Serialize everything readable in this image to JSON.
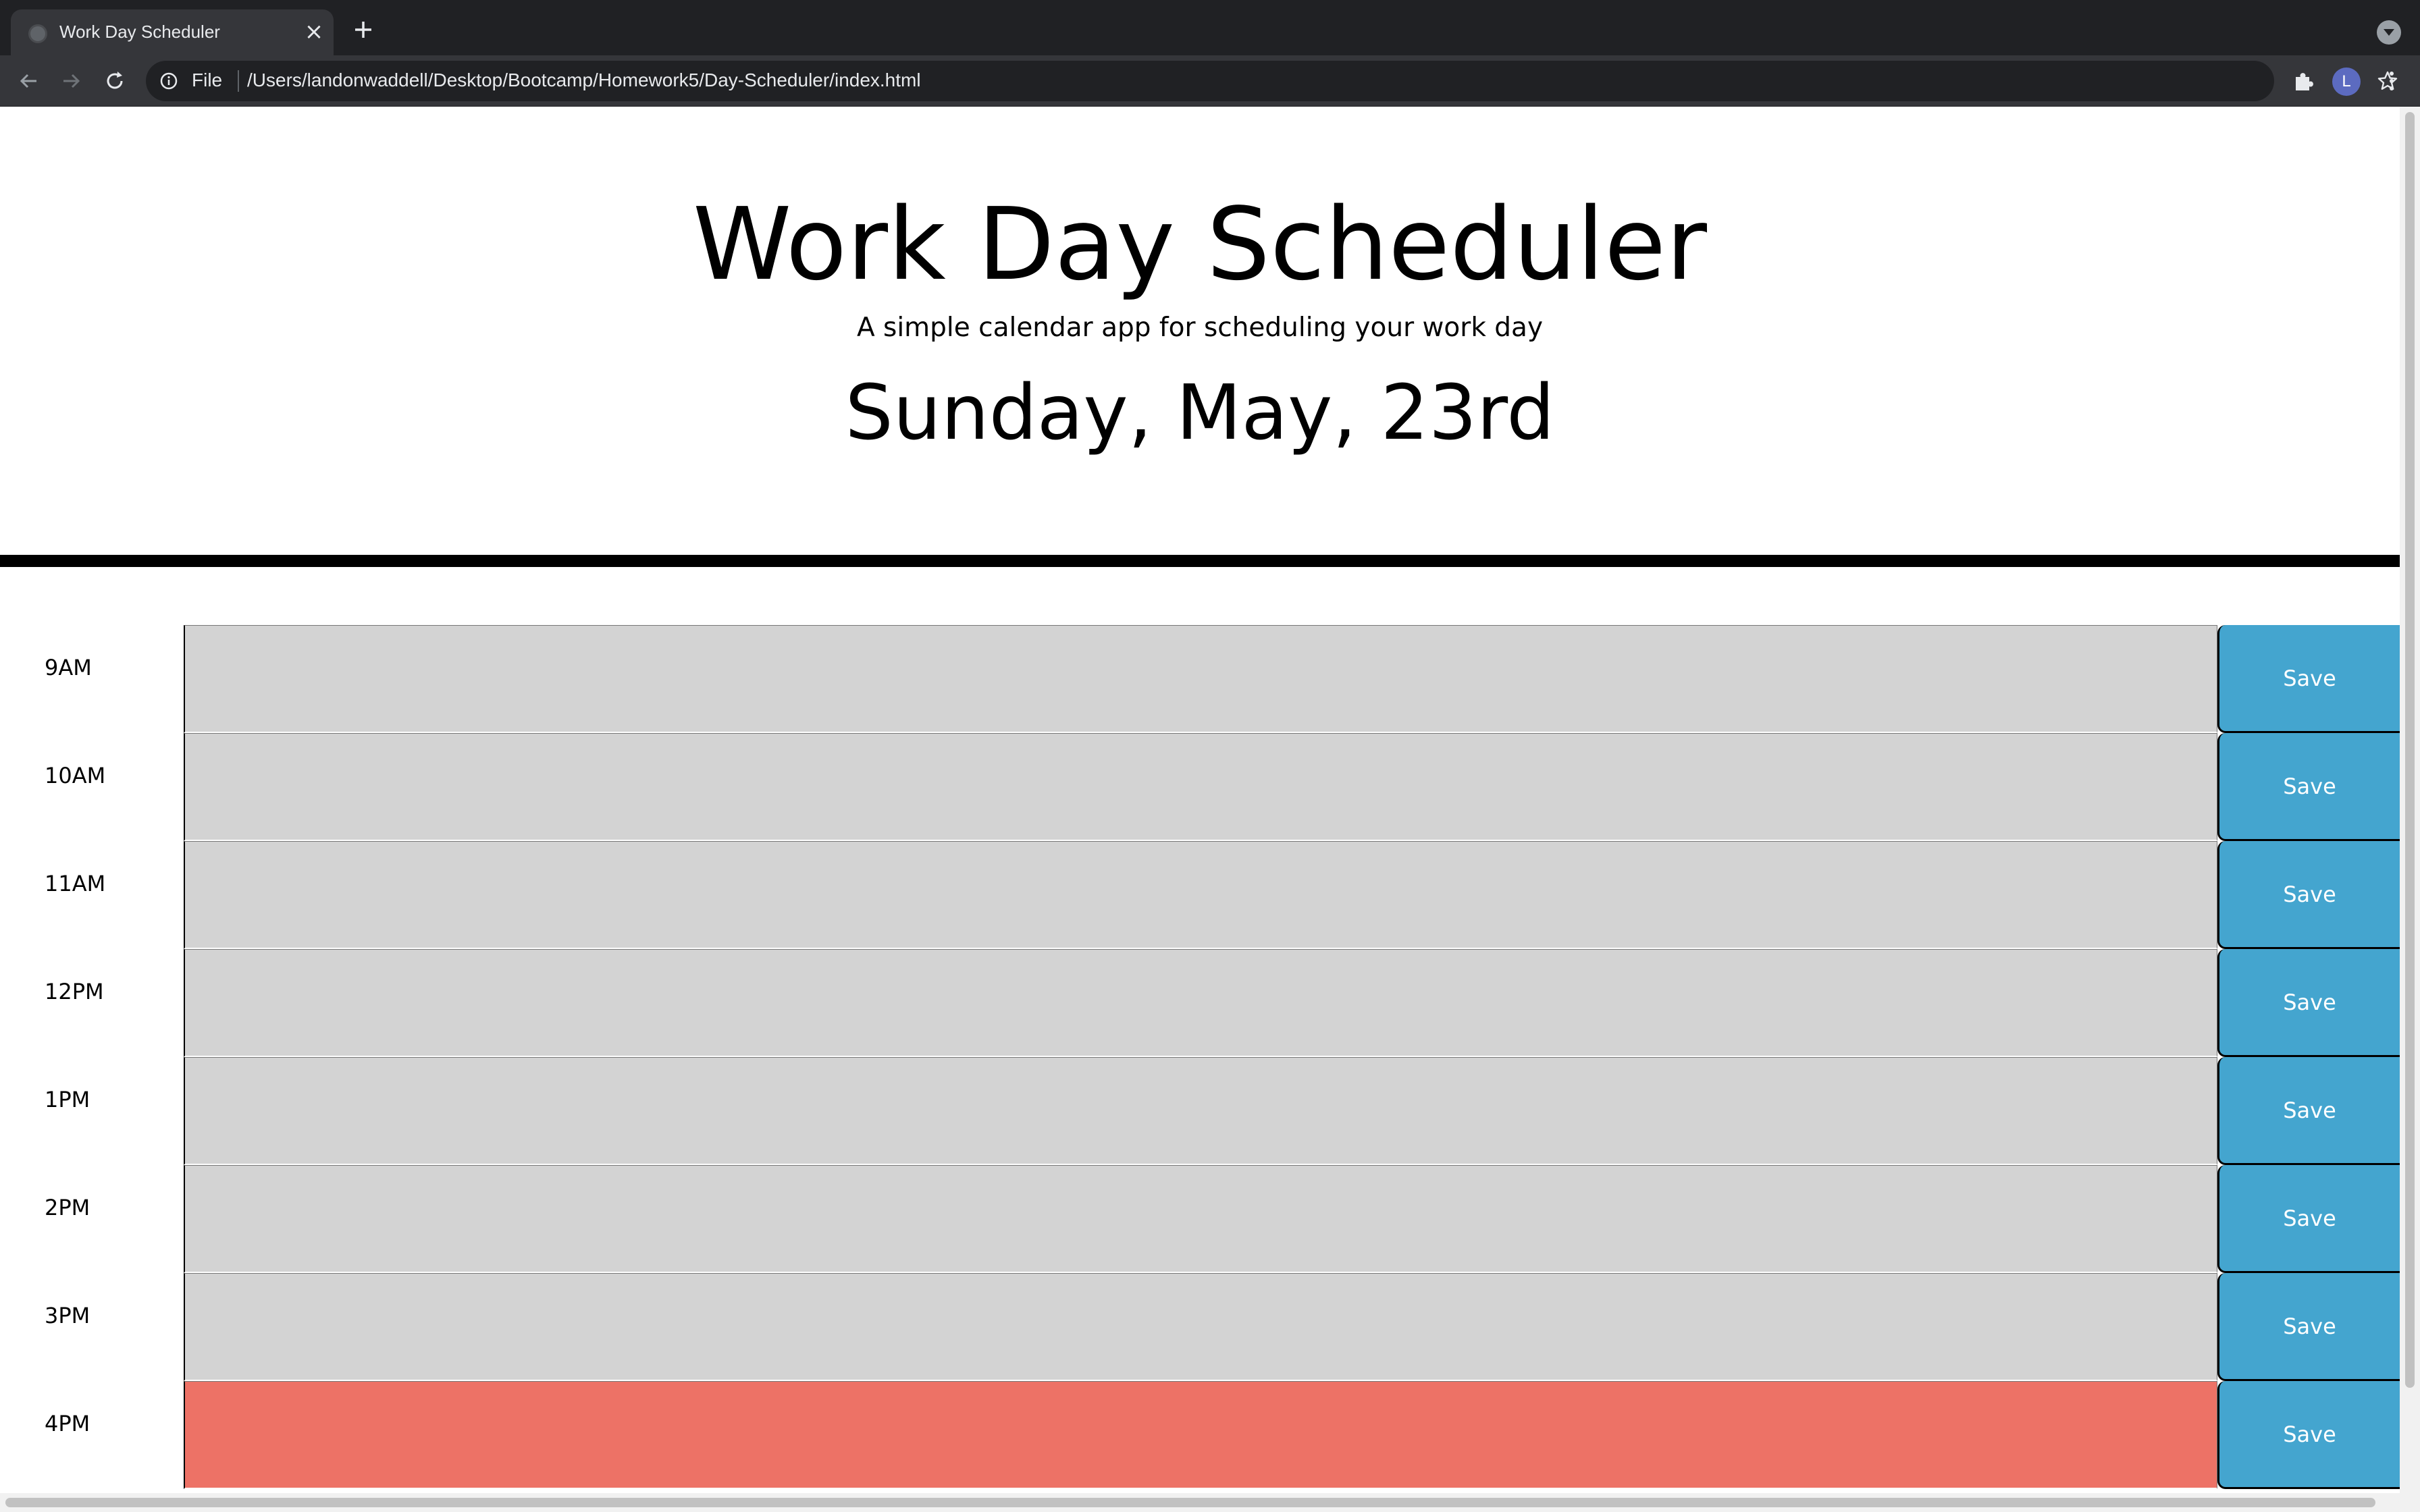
{
  "browser": {
    "tab_title": "Work Day Scheduler",
    "tab_close": "×",
    "url_scheme": "File",
    "url": "/Users/landonwaddell/Desktop/Bootcamp/Homework5/Day-Scheduler/index.html",
    "profile_initial": "L"
  },
  "header": {
    "title": "Work Day Scheduler",
    "lead": "A simple calendar app for scheduling your work day",
    "current_day": "Sunday, May, 23rd"
  },
  "timeblocks": [
    {
      "hour": "9AM",
      "state": "past",
      "text": "",
      "save_label": "Save"
    },
    {
      "hour": "10AM",
      "state": "past",
      "text": "",
      "save_label": "Save"
    },
    {
      "hour": "11AM",
      "state": "past",
      "text": "",
      "save_label": "Save"
    },
    {
      "hour": "12PM",
      "state": "past",
      "text": "",
      "save_label": "Save"
    },
    {
      "hour": "1PM",
      "state": "past",
      "text": "",
      "save_label": "Save"
    },
    {
      "hour": "2PM",
      "state": "past",
      "text": "",
      "save_label": "Save"
    },
    {
      "hour": "3PM",
      "state": "past",
      "text": "",
      "save_label": "Save"
    },
    {
      "hour": "4PM",
      "state": "present",
      "text": "",
      "save_label": "Save"
    }
  ],
  "colors": {
    "past": "#d3d3d3",
    "present": "#ed7266",
    "future": "#77dd77",
    "save_button": "#44a5cf"
  }
}
